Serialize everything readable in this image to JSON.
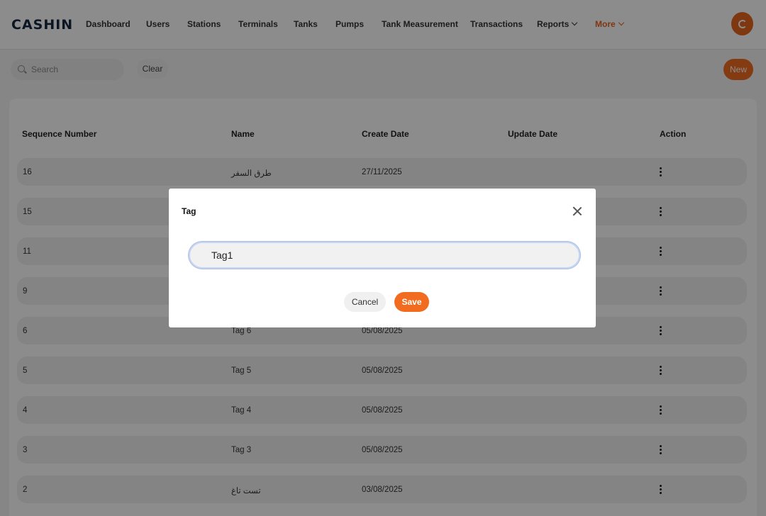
{
  "app": {
    "logo": "CASHIN"
  },
  "nav": {
    "items": [
      "Dashboard",
      "Users",
      "Stations",
      "Terminals",
      "Tanks",
      "Pumps",
      "Tank Measurement",
      "Transactions"
    ],
    "reports": "Reports",
    "more": "More"
  },
  "toolbar": {
    "search_placeholder": "Search",
    "clear_label": "Clear",
    "new_label": "New"
  },
  "table": {
    "columns": [
      "Sequence Number",
      "Name",
      "Create Date",
      "Update Date",
      "Action"
    ],
    "rows": [
      {
        "seq": "16",
        "name": "طرق السفر",
        "created": "27/11/2025",
        "updated": ""
      },
      {
        "seq": "15",
        "name": "",
        "created": "",
        "updated": ""
      },
      {
        "seq": "11",
        "name": "",
        "created": "",
        "updated": ""
      },
      {
        "seq": "9",
        "name": "",
        "created": "",
        "updated": ""
      },
      {
        "seq": "6",
        "name": "Tag 6",
        "created": "05/08/2025",
        "updated": ""
      },
      {
        "seq": "5",
        "name": "Tag 5",
        "created": "05/08/2025",
        "updated": ""
      },
      {
        "seq": "4",
        "name": "Tag 4",
        "created": "05/08/2025",
        "updated": ""
      },
      {
        "seq": "3",
        "name": "Tag 3",
        "created": "05/08/2025",
        "updated": ""
      },
      {
        "seq": "2",
        "name": "تست تاغ",
        "created": "03/08/2025",
        "updated": ""
      }
    ]
  },
  "modal": {
    "title": "Tag",
    "input_value": "Tag1",
    "cancel_label": "Cancel",
    "save_label": "Save"
  },
  "colors": {
    "accent": "#f26c1f",
    "logo": "#17283f",
    "overlay": "rgba(0,0,0,0.45)"
  }
}
